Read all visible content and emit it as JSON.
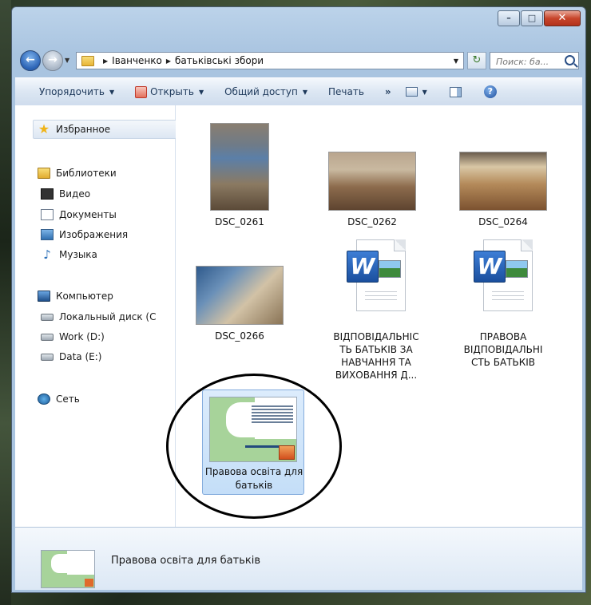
{
  "window": {
    "caption_buttons": {
      "minimize": "–",
      "maximize": "□",
      "close": "✕"
    }
  },
  "address": {
    "crumbs": [
      "Іванченко",
      "батьківські збори"
    ],
    "search_placeholder": "Поиск: ба..."
  },
  "toolbar": {
    "organize": "Упорядочить",
    "open": "Открыть",
    "share": "Общий доступ",
    "print": "Печать",
    "more": "»"
  },
  "nav": {
    "favorites": "Избранное",
    "libraries": "Библиотеки",
    "video": "Видео",
    "documents": "Документы",
    "images": "Изображения",
    "music": "Музыка",
    "computer": "Компьютер",
    "local_disk": "Локальный диск (C",
    "work": "Work (D:)",
    "data": "Data (E:)",
    "network": "Сеть"
  },
  "files": {
    "f1": "DSC_0261",
    "f2": "DSC_0262",
    "f3": "DSC_0264",
    "f4": "DSC_0266",
    "f5": "ВІДПОВІДАЛЬНІСТЬ БАТЬКІВ ЗА НАВЧАННЯ ТА ВИХОВАННЯ Д...",
    "f6": "ПРАВОВА ВІДПОВІДАЛЬНІСТЬ БАТЬКІВ",
    "f7": "Правова освіта для батьків"
  },
  "details": {
    "name": "Правова освіта для батьків"
  }
}
